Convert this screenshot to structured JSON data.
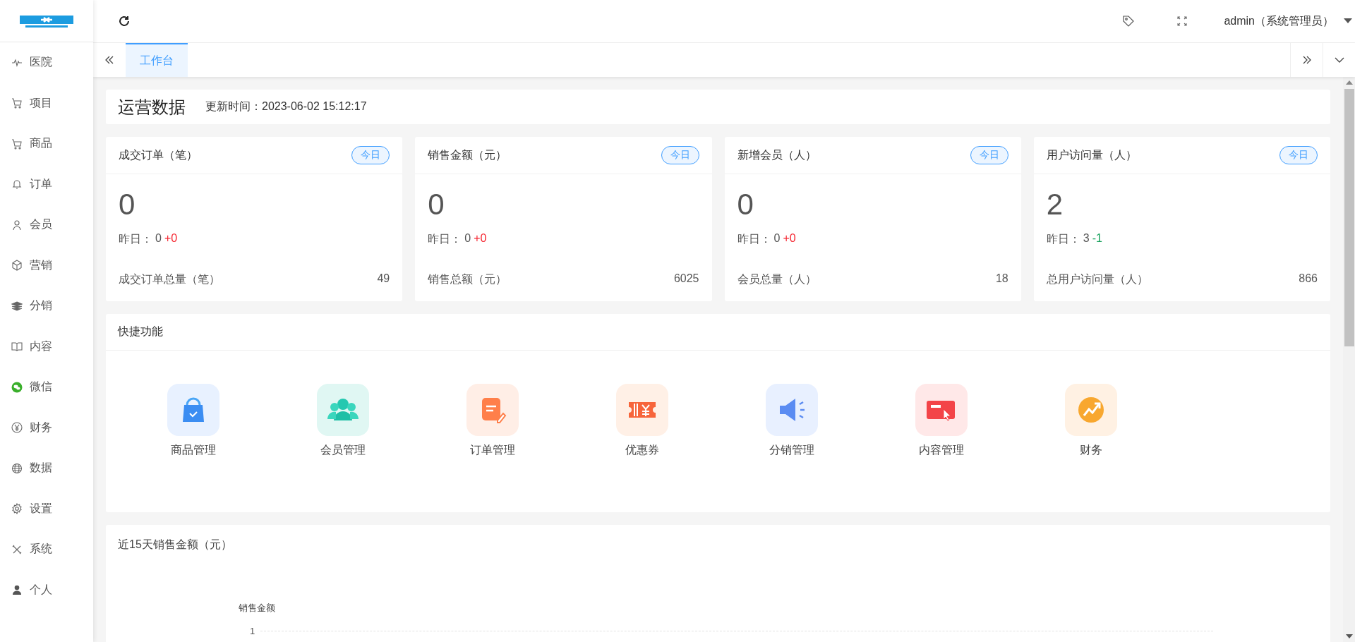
{
  "sidebar": {
    "items": [
      {
        "label": "医院",
        "selected": false
      },
      {
        "label": "项目",
        "selected": false
      },
      {
        "label": "商品",
        "selected": false
      },
      {
        "label": "订单",
        "selected": false
      },
      {
        "label": "会员",
        "selected": false
      },
      {
        "label": "营销",
        "selected": false
      },
      {
        "label": "分销",
        "selected": false
      },
      {
        "label": "内容",
        "selected": false
      },
      {
        "label": "微信",
        "selected": false
      },
      {
        "label": "财务",
        "selected": false
      },
      {
        "label": "数据",
        "selected": false
      },
      {
        "label": "设置",
        "selected": false
      },
      {
        "label": "系统",
        "selected": false
      },
      {
        "label": "个人",
        "selected": false
      }
    ]
  },
  "header": {
    "user": "admin（系统管理员）"
  },
  "tabs": [
    {
      "label": "工作台",
      "selected": true
    }
  ],
  "overview": {
    "title": "运营数据",
    "updated": "更新时间：2023-06-02 15:12:17"
  },
  "stats": [
    {
      "title": "成交订单（笔）",
      "badge": "今日",
      "value": "0",
      "yesterday_label": "昨日：",
      "yesterday": "0",
      "delta": "+0",
      "color": "#f5222d",
      "total_label": "成交订单总量（笔）",
      "total": "49"
    },
    {
      "title": "销售金额（元）",
      "badge": "今日",
      "value": "0",
      "yesterday_label": "昨日：",
      "yesterday": "0",
      "delta": "+0",
      "color": "#f5222d",
      "total_label": "销售总额（元）",
      "total": "6025"
    },
    {
      "title": "新增会员（人）",
      "badge": "今日",
      "value": "0",
      "yesterday_label": "昨日：",
      "yesterday": "0",
      "delta": "+0",
      "color": "#f5222d",
      "total_label": "会员总量（人）",
      "total": "18"
    },
    {
      "title": "用户访问量（人）",
      "badge": "今日",
      "value": "2",
      "yesterday_label": "昨日：",
      "yesterday": "3",
      "delta": "-1",
      "color": "#13a05a",
      "total_label": "总用户访问量（人）",
      "total": "866"
    }
  ],
  "shortcuts": {
    "title": "快捷功能",
    "items": [
      {
        "label": "商品管理"
      },
      {
        "label": "会员管理"
      },
      {
        "label": "订单管理"
      },
      {
        "label": "优惠券"
      },
      {
        "label": "分销管理"
      },
      {
        "label": "内容管理"
      },
      {
        "label": "财务"
      }
    ]
  },
  "sales_chart": {
    "title": "近15天销售金额（元）",
    "ylabel": "销售金额",
    "ytick": "1"
  }
}
